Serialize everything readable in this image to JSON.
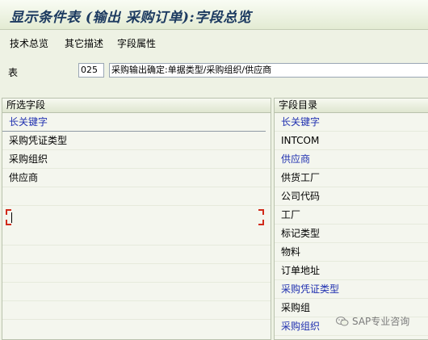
{
  "window": {
    "title": "显示条件表 (输出 采购订单):字段总览"
  },
  "menu": {
    "items": [
      "技术总览",
      "其它描述",
      "字段属性"
    ]
  },
  "table_row": {
    "label": "表",
    "code": "025",
    "description": "采购输出确定:单据类型/采购组织/供应商"
  },
  "selected_fields": {
    "header": "所选字段",
    "key_label": "长关键字",
    "items": [
      "采购凭证类型",
      "采购组织",
      "供应商"
    ]
  },
  "field_catalog": {
    "header": "字段目录",
    "key_label": "长关键字",
    "items": [
      {
        "label": "INTCOM",
        "color": "#000000"
      },
      {
        "label": "供应商",
        "color": "#2030b0"
      },
      {
        "label": "供货工厂",
        "color": "#000000"
      },
      {
        "label": "公司代码",
        "color": "#000000"
      },
      {
        "label": "工厂",
        "color": "#000000"
      },
      {
        "label": "标记类型",
        "color": "#000000"
      },
      {
        "label": "物料",
        "color": "#000000"
      },
      {
        "label": "订单地址",
        "color": "#000000"
      },
      {
        "label": "采购凭证类型",
        "color": "#2030b0"
      },
      {
        "label": "采购组",
        "color": "#000000"
      },
      {
        "label": "采购组织",
        "color": "#2030b0"
      }
    ]
  },
  "watermark": {
    "text": "SAP专业咨询",
    "icon": "wechat-icon"
  },
  "colors": {
    "highlight": "#2030b0",
    "focus_frame": "#d12a1a"
  }
}
